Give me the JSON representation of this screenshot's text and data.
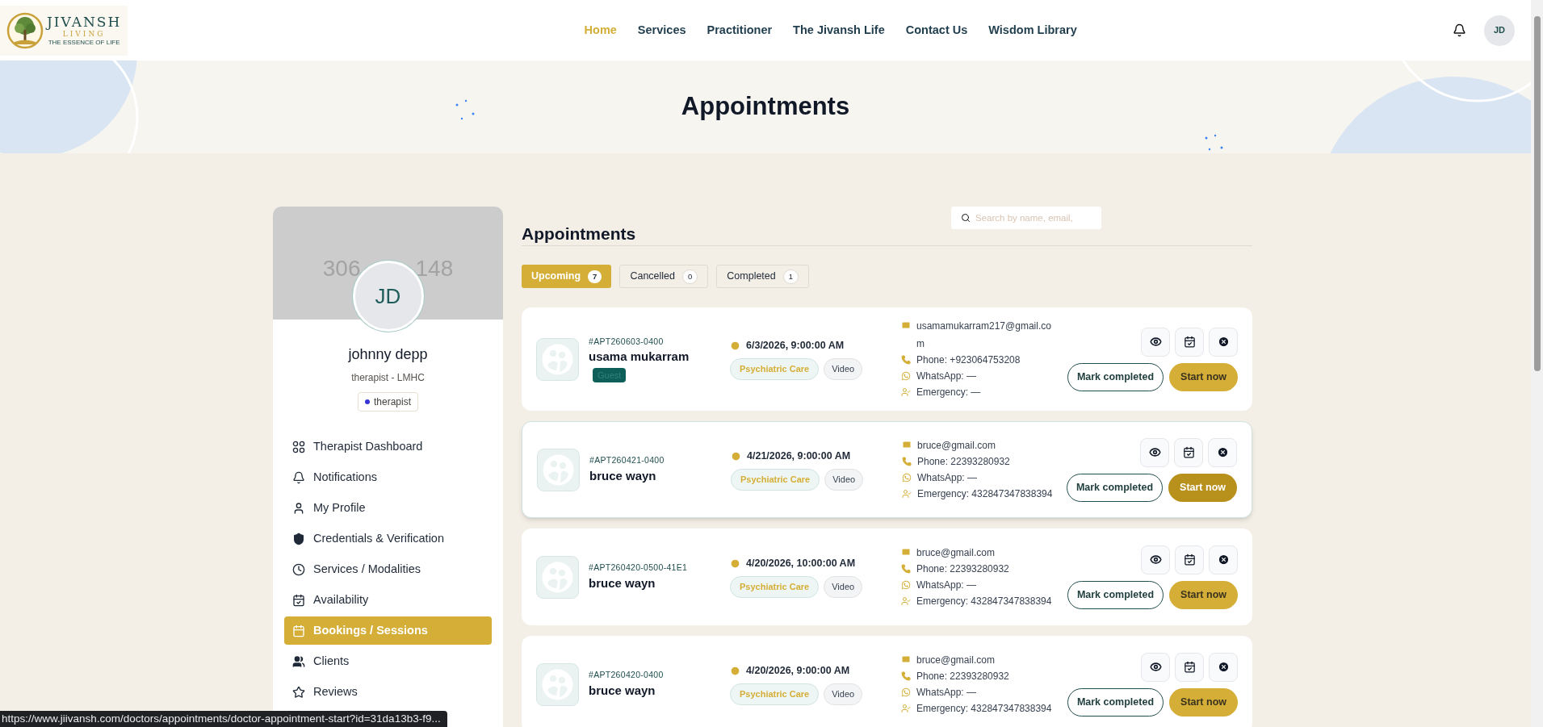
{
  "header": {
    "logo": {
      "name": "JIVANSH",
      "sub": "LIVING",
      "tagline": "THE ESSENCE OF LIFE"
    },
    "nav": [
      {
        "label": "Home",
        "selected": true
      },
      {
        "label": "Services",
        "selected": false
      },
      {
        "label": "Practitioner",
        "selected": false
      },
      {
        "label": "The Jivansh Life",
        "selected": false
      },
      {
        "label": "Contact Us",
        "selected": false
      },
      {
        "label": "Wisdom Library",
        "selected": false
      }
    ],
    "avatar": "JD"
  },
  "hero": {
    "title": "Appointments"
  },
  "profile": {
    "cover_text": [
      "306",
      "148"
    ],
    "initials": "JD",
    "name": "johnny depp",
    "subtitle": "therapist - LMHC",
    "role": {
      "label": "therapist",
      "color": "#3434d6"
    },
    "menu": [
      {
        "label": "Therapist Dashboard",
        "selected": false
      },
      {
        "label": "Notifications",
        "selected": false
      },
      {
        "label": "My Profile",
        "selected": false
      },
      {
        "label": "Credentials & Verification",
        "selected": false
      },
      {
        "label": "Services / Modalities",
        "selected": false
      },
      {
        "label": "Availability",
        "selected": false
      },
      {
        "label": "Bookings / Sessions",
        "selected": true
      },
      {
        "label": "Clients",
        "selected": false
      },
      {
        "label": "Reviews",
        "selected": false
      }
    ]
  },
  "main": {
    "title": "Appointments",
    "search": {
      "placeholder": "Search by name, email,"
    },
    "tabs": [
      {
        "label": "Upcoming",
        "count": "7",
        "selected": true
      },
      {
        "label": "Cancelled",
        "count": "0",
        "selected": false
      },
      {
        "label": "Completed",
        "count": "1",
        "selected": false
      }
    ],
    "appointments": [
      {
        "id": "#APT260603-0400",
        "name": "usama mukarram",
        "badge": "Guest",
        "datetime": "6/3/2026, 9:00:00 AM",
        "service": "Psychiatric Care",
        "mode": "Video",
        "email": [
          "usamamukarram217@gmail.co",
          "m"
        ],
        "phone": "Phone: +923064753208",
        "whatsapp": "WhatsApp: —",
        "emergency": "Emergency: —",
        "mark_label": "Mark completed",
        "start_label": "Start now",
        "hovered": false
      },
      {
        "id": "#APT260421-0400",
        "name": "bruce wayn",
        "datetime": "4/21/2026, 9:00:00 AM",
        "service": "Psychiatric Care",
        "mode": "Video",
        "email": [
          "bruce@gmail.com"
        ],
        "phone": "Phone: 22393280932",
        "whatsapp": "WhatsApp: —",
        "emergency": "Emergency: 432847347838394",
        "mark_label": "Mark completed",
        "start_label": "Start now",
        "hovered": true
      },
      {
        "id": "#APT260420-0500-41E1",
        "name": "bruce wayn",
        "datetime": "4/20/2026, 10:00:00 AM",
        "service": "Psychiatric Care",
        "mode": "Video",
        "email": [
          "bruce@gmail.com"
        ],
        "phone": "Phone: 22393280932",
        "whatsapp": "WhatsApp: —",
        "emergency": "Emergency: 432847347838394",
        "mark_label": "Mark completed",
        "start_label": "Start now",
        "hovered": false
      },
      {
        "id": "#APT260420-0400",
        "name": "bruce wayn",
        "datetime": "4/20/2026, 9:00:00 AM",
        "service": "Psychiatric Care",
        "mode": "Video",
        "email": [
          "bruce@gmail.com"
        ],
        "phone": "Phone: 22393280932",
        "whatsapp": "WhatsApp: —",
        "emergency": "Emergency: 432847347838394",
        "mark_label": "Mark completed",
        "start_label": "Start now",
        "hovered": false
      }
    ]
  },
  "status_url": "https://www.jiivansh.com/doctors/appointments/doctor-appointment-start?id=31da13b3-f9..."
}
